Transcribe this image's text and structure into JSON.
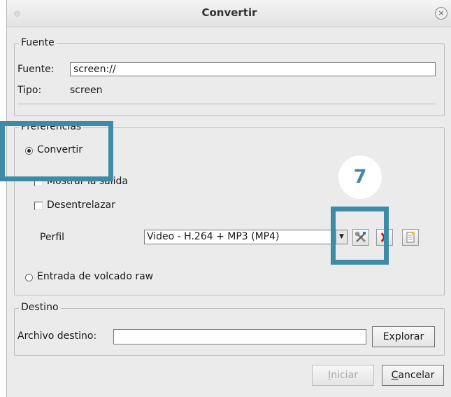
{
  "window": {
    "title": "Convertir",
    "close_label": "×"
  },
  "source": {
    "group_label": "Fuente",
    "source_label": "Fuente:",
    "source_value": "screen://",
    "type_label": "Tipo:",
    "type_value": "screen"
  },
  "preferences": {
    "group_label": "Preferencias",
    "convert_label": "Convertir",
    "convert_selected": true,
    "show_output_label": "Mostrar la salida",
    "show_output_checked": false,
    "deinterlace_label": "Desentrelazar",
    "deinterlace_checked": false,
    "profile_label": "Perfil",
    "profile_value": "Video - H.264 + MP3 (MP4)",
    "raw_dump_label": "Entrada de volcado raw",
    "raw_dump_selected": false,
    "edit_profile_icon": "wrench-screwdriver-icon",
    "delete_profile_icon": "red-x-icon",
    "new_profile_icon": "new-document-icon"
  },
  "destination": {
    "group_label": "Destino",
    "file_label": "Archivo destino:",
    "file_value": "",
    "browse_label": "Explorar"
  },
  "buttons": {
    "start_first": "I",
    "start_rest": "niciar",
    "cancel_first": "C",
    "cancel_rest": "ancelar"
  },
  "annotation": {
    "step_number": "7",
    "accent_color": "#3d8ba6"
  }
}
